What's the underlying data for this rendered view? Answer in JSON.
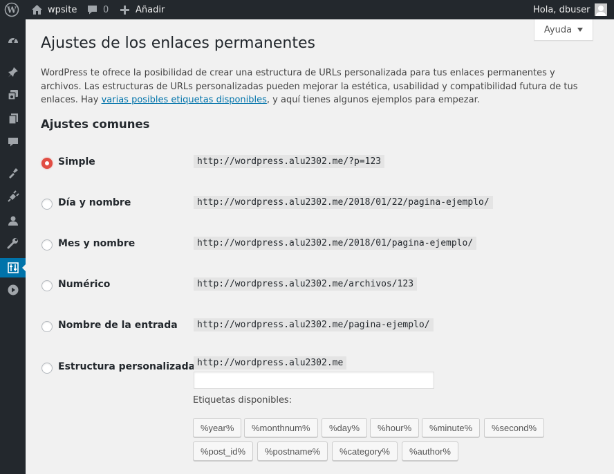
{
  "adminbar": {
    "site_name": "wpsite",
    "comments_count": "0",
    "new_label": "Añadir",
    "greeting": "Hola, dbuser"
  },
  "help": {
    "label": "Ayuda"
  },
  "page": {
    "title": "Ajustes de los enlaces permanentes",
    "intro_text": "WordPress te ofrece la posibilidad de crear una estructura de URLs personalizada para tus enlaces permanentes y archivos. Las estructuras de URLs personalizadas pueden mejorar la estética, usabilidad y compatibilidad futura de tus enlaces. Hay ",
    "intro_link": "varias posibles etiquetas disponibles",
    "intro_tail": ", y aquí tienes algunos ejemplos para empezar.",
    "section_heading": "Ajustes comunes"
  },
  "options": [
    {
      "label": "Simple",
      "example": "http://wordpress.alu2302.me/?p=123",
      "checked": true
    },
    {
      "label": "Día y nombre",
      "example": "http://wordpress.alu2302.me/2018/01/22/pagina-ejemplo/",
      "checked": false
    },
    {
      "label": "Mes y nombre",
      "example": "http://wordpress.alu2302.me/2018/01/pagina-ejemplo/",
      "checked": false
    },
    {
      "label": "Numérico",
      "example": "http://wordpress.alu2302.me/archivos/123",
      "checked": false
    },
    {
      "label": "Nombre de la entrada",
      "example": "http://wordpress.alu2302.me/pagina-ejemplo/",
      "checked": false
    },
    {
      "label": "Estructura personalizada",
      "example": "http://wordpress.alu2302.me",
      "checked": false
    }
  ],
  "custom_structure": {
    "value": ""
  },
  "tags": {
    "label": "Etiquetas disponibles:",
    "items": [
      "%year%",
      "%monthnum%",
      "%day%",
      "%hour%",
      "%minute%",
      "%second%",
      "%post_id%",
      "%postname%",
      "%category%",
      "%author%"
    ]
  },
  "colors": {
    "adminbar": "#23282d",
    "accent": "#0073aa",
    "radio_checked": "#e14d43"
  },
  "icons": [
    "wordpress-logo-icon",
    "home-icon",
    "comment-icon",
    "plus-icon",
    "avatar",
    "dashboard-icon",
    "pin-icon",
    "media-icon",
    "pages-icon",
    "comments-icon",
    "appearance-icon",
    "plugins-icon",
    "users-icon",
    "tools-icon",
    "settings-icon",
    "collapse-icon"
  ]
}
